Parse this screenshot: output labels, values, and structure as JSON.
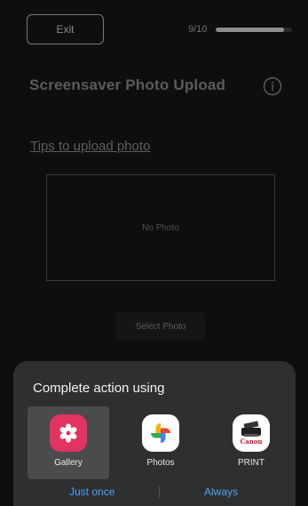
{
  "header": {
    "exit_label": "Exit",
    "progress_label": "9/10",
    "progress_value": 0.9
  },
  "main": {
    "title": "Screensaver Photo Upload",
    "tips_link": "Tips to upload photo",
    "photo_placeholder": "No Photo",
    "select_button": "Select Photo"
  },
  "sheet": {
    "title": "Complete action using",
    "apps": [
      {
        "label": "Gallery",
        "icon": "gallery-icon",
        "selected": true
      },
      {
        "label": "Photos",
        "icon": "google-photos-icon",
        "selected": false
      },
      {
        "label": "PRINT",
        "icon": "canon-print-icon",
        "selected": false
      }
    ],
    "just_once": "Just once",
    "always": "Always"
  },
  "colors": {
    "accent": "#4ea3f5",
    "gallery_bg": "#e23361",
    "sheet_bg": "#2e2f31"
  }
}
